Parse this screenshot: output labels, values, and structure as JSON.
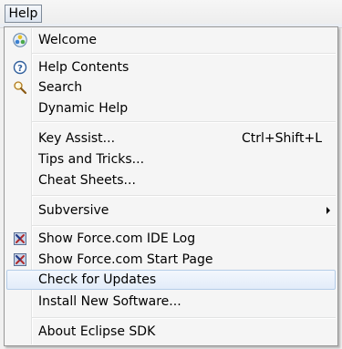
{
  "menubar": {
    "help_label": "Help"
  },
  "menu": {
    "items": [
      {
        "label": "Welcome",
        "icon": "welcome-icon"
      },
      {
        "label": "Help Contents",
        "icon": "help-contents-icon"
      },
      {
        "label": "Search",
        "icon": "search-icon"
      },
      {
        "label": "Dynamic Help"
      },
      {
        "label": "Key Assist...",
        "shortcut": "Ctrl+Shift+L"
      },
      {
        "label": "Tips and Tricks..."
      },
      {
        "label": "Cheat Sheets..."
      },
      {
        "label": "Subversive",
        "submenu": true
      },
      {
        "label": "Show Force.com IDE Log",
        "icon": "force-com-icon"
      },
      {
        "label": "Show Force.com Start Page",
        "icon": "force-com-icon"
      },
      {
        "label": "Check for Updates",
        "highlighted": true
      },
      {
        "label": "Install New Software..."
      },
      {
        "label": "About Eclipse SDK"
      }
    ]
  },
  "colors": {
    "highlight_border": "#b5cde8",
    "menu_background": "#f5f5f5"
  }
}
